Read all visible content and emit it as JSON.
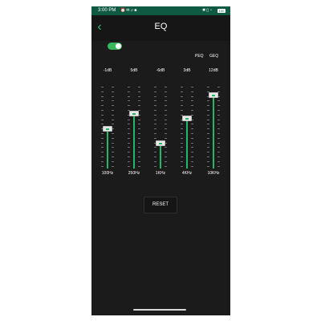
{
  "status_bar": {
    "time": "3:00 PM",
    "left_icons": [
      "alarm-icon",
      "message-icon",
      "notification-icon",
      "app-icon"
    ],
    "right_icons": [
      "bluetooth-icon",
      "vibrate-icon",
      "wifi-icon"
    ],
    "battery": "100"
  },
  "app_bar": {
    "title": "EQ"
  },
  "mode_toggle": {
    "on": true,
    "left_label": "PEQ",
    "right_label": "GEQ",
    "accent": "#36b85c"
  },
  "bands": [
    {
      "gain": "-1dB",
      "freq": "100Hz",
      "level": 0.48
    },
    {
      "gain": "5dB",
      "freq": "250Hz",
      "level": 0.68
    },
    {
      "gain": "-6dB",
      "freq": "1KHz",
      "level": 0.3
    },
    {
      "gain": "3dB",
      "freq": "4KHz",
      "level": 0.62
    },
    {
      "gain": "12dB",
      "freq": "10KHz",
      "level": 0.93
    }
  ],
  "reset_button": {
    "label": "RESET"
  },
  "colors": {
    "background": "#1b1b1b",
    "status_bar": "#0f5a43",
    "accent": "#24b866"
  }
}
